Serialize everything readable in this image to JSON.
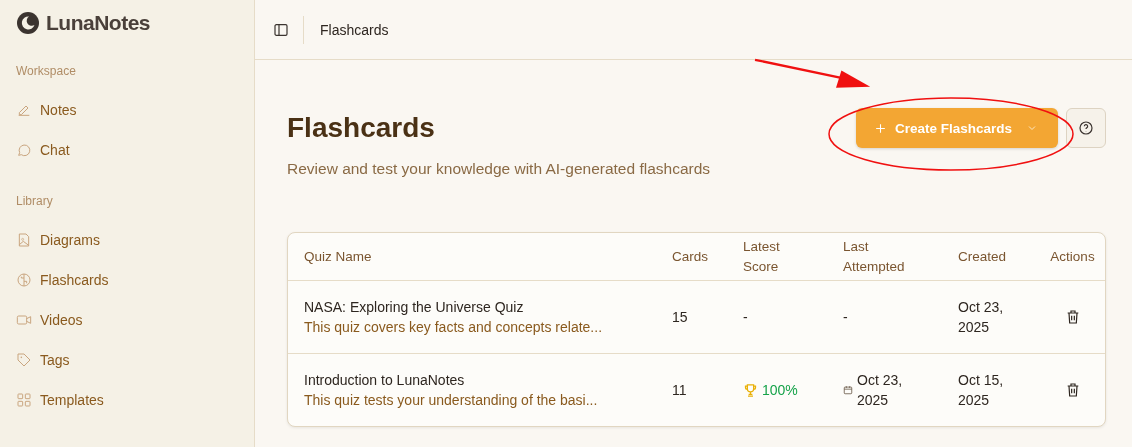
{
  "app": {
    "name": "LunaNotes"
  },
  "sidebar": {
    "sections": [
      {
        "heading": "Workspace",
        "items": [
          {
            "label": "Notes",
            "kind": "pencil"
          },
          {
            "label": "Chat",
            "kind": "chat"
          }
        ]
      },
      {
        "heading": "Library",
        "items": [
          {
            "label": "Diagrams",
            "kind": "image"
          },
          {
            "label": "Flashcards",
            "kind": "brain"
          },
          {
            "label": "Videos",
            "kind": "video"
          },
          {
            "label": "Tags",
            "kind": "tag"
          },
          {
            "label": "Templates",
            "kind": "grid"
          }
        ]
      }
    ]
  },
  "topbar": {
    "breadcrumb": "Flashcards"
  },
  "page": {
    "title": "Flashcards",
    "subtitle": "Review and test your knowledge with AI-generated flashcards",
    "create_button": "Create Flashcards"
  },
  "table": {
    "columns": [
      "Quiz Name",
      "Cards",
      "Latest Score",
      "Last Attempted",
      "Created",
      "Actions"
    ],
    "rows": [
      {
        "name": "NASA: Exploring the Universe Quiz",
        "description": "This quiz covers key facts and concepts relate...",
        "cards": "15",
        "score": {
          "kind": "none",
          "text": "-"
        },
        "last_attempted": {
          "kind": "none",
          "text": "-"
        },
        "created": "Oct 23, 2025"
      },
      {
        "name": "Introduction to LunaNotes",
        "description": "This quiz tests your understanding of the basi...",
        "cards": "11",
        "score": {
          "kind": "trophy",
          "text": "100%"
        },
        "last_attempted": {
          "kind": "date",
          "text": "Oct 23, 2025"
        },
        "created": "Oct 15, 2025"
      }
    ]
  }
}
